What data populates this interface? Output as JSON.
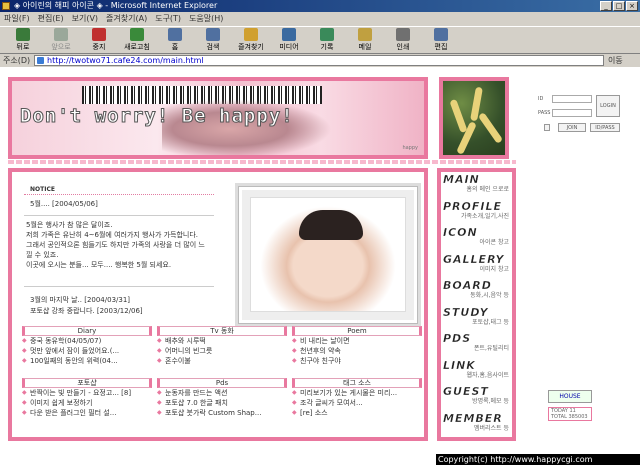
{
  "window": {
    "title": "◈ 아이린의 해피 아이콘 ◈ - Microsoft Internet Explorer"
  },
  "menu": [
    "파일(F)",
    "편집(E)",
    "보기(V)",
    "즐겨찾기(A)",
    "도구(T)",
    "도움말(H)"
  ],
  "toolbar": [
    {
      "label": "뒤로",
      "icon": "back-arrow-icon",
      "color": "#3a7a3a"
    },
    {
      "label": "앞으로",
      "icon": "forward-arrow-icon",
      "color": "#9aa89a"
    },
    {
      "label": "중지",
      "icon": "stop-icon",
      "color": "#c03030"
    },
    {
      "label": "새로고침",
      "icon": "refresh-icon",
      "color": "#3a8a3a"
    },
    {
      "label": "홈",
      "icon": "home-icon",
      "color": "#5070a0"
    },
    {
      "label": "검색",
      "icon": "search-icon",
      "color": "#5070a0"
    },
    {
      "label": "즐겨찾기",
      "icon": "favorites-icon",
      "color": "#d0a030"
    },
    {
      "label": "미디어",
      "icon": "media-icon",
      "color": "#3a6aa0"
    },
    {
      "label": "기록",
      "icon": "history-icon",
      "color": "#3a8a5a"
    },
    {
      "label": "메일",
      "icon": "mail-icon",
      "color": "#c0a040"
    },
    {
      "label": "인쇄",
      "icon": "print-icon",
      "color": "#707070"
    },
    {
      "label": "편집",
      "icon": "edit-icon",
      "color": "#5070a0"
    }
  ],
  "address": {
    "label": "주소(D)",
    "url": "http://twotwo71.cafe24.com/main.html",
    "go": "이동"
  },
  "banner": {
    "slogan": "Don't worry! Be happy!",
    "tiny": "happy"
  },
  "login": {
    "id": "ID",
    "pass": "PASS",
    "login": "LOGIN",
    "join": "JOIN",
    "idpass": "ID/PASS"
  },
  "notice": {
    "heading": "NOTICE",
    "item1": "5월....   [2004/05/06]",
    "body": [
      "5월은 행사가 참 많은 달이죠.",
      "저희 가족은 유난히 4~6월에 여러가지 행사가 가득합니다.",
      "그래서 공인적으론 힘들기도 하지만 가족의 사랑을 더 많이 느",
      "낄 수 있죠.",
      "이곳에 오시는 분들... 모두.... 행복한 5월 되세요."
    ],
    "item2": "3월의 마지막 날.. [2004/03/31]",
    "item3": "포토샵 강좌 중랍니다. [2003/12/06]"
  },
  "columns": [
    {
      "title": "Diary",
      "items": [
        "중국 동유학(04/05/07)",
        "멋만 앞에서 잠이 들었어요.(...",
        "100일째의 동안의 위력(04..."
      ]
    },
    {
      "title": "Tv 동화",
      "items": [
        "배추와 시루떡",
        "어머니의 빈그릇",
        "혼수이불"
      ]
    },
    {
      "title": "Poem",
      "items": [
        "비 내리는 날이면",
        "천년후의 약속",
        "친구야 친구야"
      ]
    },
    {
      "title": "포토샵",
      "items": [
        "반짝이는 빛 만들기 - 요정고... [8]",
        "이미지 쉽게 보정하기",
        "다운 받은 플러그인 필터 설..."
      ]
    },
    {
      "title": "Pds",
      "items": [
        "눈동자를 만드는 액션",
        "포토샵 7.0 한글 패치",
        "포토샵 붓가락 Custom Shap..."
      ]
    },
    {
      "title": "태그 소스",
      "items": [
        "미리보기가 있는 게시물은 미리...",
        "조각 글씨가 모여서...",
        "[re] 소스"
      ]
    }
  ],
  "sidemenu": [
    {
      "big": "MAIN",
      "small": "홈의 메인 으로로"
    },
    {
      "big": "PROFILE",
      "small": "가족소개,일기,사진"
    },
    {
      "big": "ICON",
      "small": "아이콘 창고"
    },
    {
      "big": "GALLERY",
      "small": "이미지 창고"
    },
    {
      "big": "BOARD",
      "small": "동화,시,음악 등"
    },
    {
      "big": "STUDY",
      "small": "포토샵,태그 등"
    },
    {
      "big": "PDS",
      "small": "폰트,유틸리티"
    },
    {
      "big": "LINK",
      "small": "웹자,홈,음사이트"
    },
    {
      "big": "GUEST",
      "small": "방명록,메모 등"
    },
    {
      "big": "MEMBER",
      "small": "멤버리스트 등"
    }
  ],
  "house": "HOUSE",
  "counter": {
    "today": "TODAY",
    "total": "TOTAL",
    "total_val": "385003",
    "today_val": "11"
  },
  "copyright": "Copyright(c) http://www.happycgi.com"
}
